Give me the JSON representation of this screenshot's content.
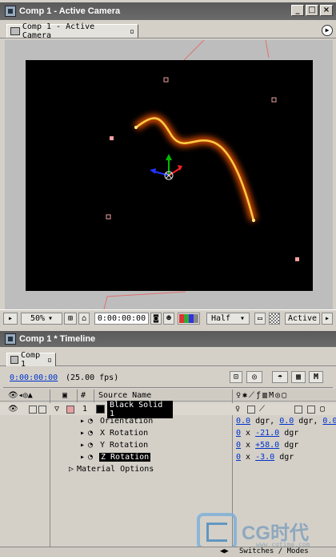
{
  "viewer_window": {
    "title": "Comp 1 - Active Camera",
    "tab_label": "Comp 1 - Active Camera"
  },
  "viewer_controls": {
    "zoom": "50%",
    "timecode": "0:00:00:00",
    "resolution": "Half",
    "view": "Active"
  },
  "timeline_window": {
    "title": "Comp 1 * Timeline",
    "tab_label": "Comp 1",
    "timecode": "0:00:00:00",
    "fps": "(25.00 fps)"
  },
  "columns": {
    "number": "#",
    "source_name": "Source Name"
  },
  "layer": {
    "index": "1",
    "name": "Black Solid 1",
    "label_color": "#e8a0a0"
  },
  "properties": [
    {
      "name": "Orientation",
      "value": "0.0 dgr, 0.0 dgr, 0.0"
    },
    {
      "name": "X Rotation",
      "value_prefix": "0",
      "value": "-21.0",
      "unit": "dgr"
    },
    {
      "name": "Y Rotation",
      "value_prefix": "0",
      "value": "+58.0",
      "unit": "dgr"
    },
    {
      "name": "Z Rotation",
      "value_prefix": "0",
      "value": "-3.0",
      "unit": "dgr"
    }
  ],
  "orientation_parts": {
    "a": "0.0",
    "b": "0.0",
    "c": "0.0",
    "unit": "dgr"
  },
  "material_options": "Material Options",
  "switches_modes": "Switches / Modes",
  "watermark": {
    "brand": "CG时代",
    "url": "www.cgtime.com"
  },
  "colors": {
    "glow_outer": "#ff6a00",
    "glow_inner": "#ffd24a",
    "handle": "#f0a0a0",
    "timecode_blue": "#0033cc",
    "titlebar": "#5e5e5e"
  }
}
